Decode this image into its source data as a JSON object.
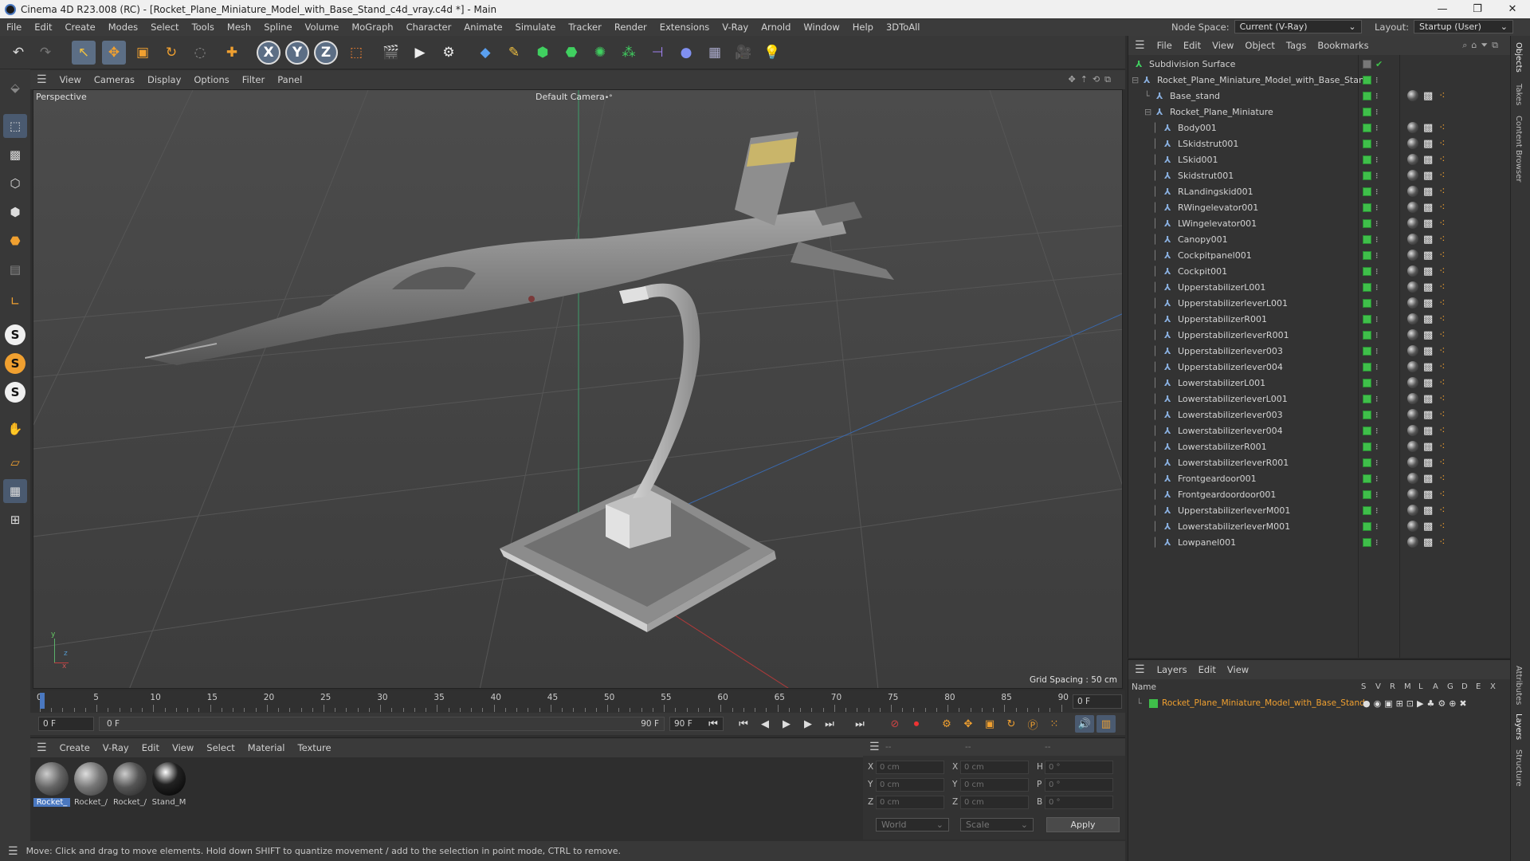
{
  "window": {
    "title": "Cinema 4D R23.008 (RC) - [Rocket_Plane_Miniature_Model_with_Base_Stand_c4d_vray.c4d *] - Main",
    "minimize": "—",
    "maximize": "❐",
    "close": "✕"
  },
  "menubar": {
    "items": [
      "File",
      "Edit",
      "Create",
      "Modes",
      "Select",
      "Tools",
      "Mesh",
      "Spline",
      "Volume",
      "MoGraph",
      "Character",
      "Animate",
      "Simulate",
      "Tracker",
      "Render",
      "Extensions",
      "V-Ray",
      "Arnold",
      "Window",
      "Help",
      "3DToAll"
    ],
    "node_space_label": "Node Space:",
    "node_space_value": "Current (V-Ray)",
    "layout_label": "Layout:",
    "layout_value": "Startup (User)"
  },
  "toolbar": {
    "icons": [
      "undo-icon",
      "redo-icon",
      "select-icon",
      "move-icon",
      "scale-icon",
      "rotate-icon",
      "lasso-icon",
      "add-icon",
      "x-axis-icon",
      "y-axis-icon",
      "z-axis-icon",
      "coordinate-system-icon",
      "render-region-icon",
      "render-view-icon",
      "render-settings-icon",
      "cube-icon",
      "pen-icon",
      "subdivision-icon",
      "extrude-icon",
      "cloner-icon",
      "array-icon",
      "deformer-icon",
      "field-icon",
      "floor-icon",
      "camera-icon",
      "light-icon"
    ],
    "x_label": "X",
    "y_label": "Y",
    "z_label": "Z"
  },
  "viewport": {
    "menu": [
      "View",
      "Cameras",
      "Display",
      "Options",
      "Filter",
      "Panel"
    ],
    "label": "Perspective",
    "camera": "Default Camera",
    "camera_mark": "•°",
    "grid_spacing": "Grid Spacing : 50 cm",
    "axis_y": "y",
    "axis_z": "z",
    "axis_x": "x"
  },
  "timeline": {
    "ticks": [
      "0",
      "5",
      "10",
      "15",
      "20",
      "25",
      "30",
      "35",
      "40",
      "45",
      "50",
      "55",
      "60",
      "65",
      "70",
      "75",
      "80",
      "85",
      "90"
    ],
    "current": "0 F"
  },
  "playbar": {
    "start": "0 F",
    "range_start": "0 F",
    "range_end": "90 F",
    "end": "90 F"
  },
  "materials": {
    "menu": [
      "Create",
      "V-Ray",
      "Edit",
      "View",
      "Select",
      "Material",
      "Texture"
    ],
    "items": [
      {
        "label": "Rocket_",
        "selected": true
      },
      {
        "label": "Rocket_/",
        "selected": false
      },
      {
        "label": "Rocket_/",
        "selected": false
      },
      {
        "label": "Stand_M",
        "selected": false
      }
    ]
  },
  "coords": {
    "header": [
      "--",
      "--",
      "--"
    ],
    "rows": [
      {
        "a": "X",
        "av": "0 cm",
        "b": "X",
        "bv": "0 cm",
        "c": "H",
        "cv": "0 °"
      },
      {
        "a": "Y",
        "av": "0 cm",
        "b": "Y",
        "bv": "0 cm",
        "c": "P",
        "cv": "0 °"
      },
      {
        "a": "Z",
        "av": "0 cm",
        "b": "Z",
        "bv": "0 cm",
        "c": "B",
        "cv": "0 °"
      }
    ],
    "world": "World",
    "scale": "Scale",
    "apply": "Apply"
  },
  "status": "Move: Click and drag to move elements. Hold down SHIFT to quantize movement / add to the selection in point mode, CTRL to remove.",
  "objects": {
    "menu": [
      "File",
      "Edit",
      "View",
      "Object",
      "Tags",
      "Bookmarks"
    ],
    "root": "Subdivision Surface",
    "model": "Rocket_Plane_Miniature_Model_with_Base_Stand",
    "base": "Base_stand",
    "group": "Rocket_Plane_Miniature",
    "children": [
      "Body001",
      "LSkidstrut001",
      "LSkid001",
      "Skidstrut001",
      "RLandingskid001",
      "RWingelevator001",
      "LWingelevator001",
      "Canopy001",
      "Cockpitpanel001",
      "Cockpit001",
      "UpperstabilizerL001",
      "UpperstabilizerleverL001",
      "UpperstabilizerR001",
      "UpperstabilizerleverR001",
      "Upperstabilizerlever003",
      "Upperstabilizerlever004",
      "LowerstabilizerL001",
      "LowerstabilizerleverL001",
      "Lowerstabilizerlever003",
      "Lowerstabilizerlever004",
      "LowerstabilizerR001",
      "LowerstabilizerleverR001",
      "Frontgeardoor001",
      "Frontgeardoordoor001",
      "UpperstabilizerleverM001",
      "LowerstabilizerleverM001",
      "Lowpanel001"
    ]
  },
  "layers": {
    "menu": [
      "Layers",
      "Edit",
      "View"
    ],
    "name_header": "Name",
    "cols": [
      "S",
      "V",
      "R",
      "M",
      "L",
      "A",
      "G",
      "D",
      "E",
      "X"
    ],
    "layer": "Rocket_Plane_Miniature_Model_with_Base_Stand"
  },
  "side_tabs": [
    "Objects",
    "Takes",
    "Content Browser",
    "Attributes",
    "Layers",
    "Structure"
  ]
}
